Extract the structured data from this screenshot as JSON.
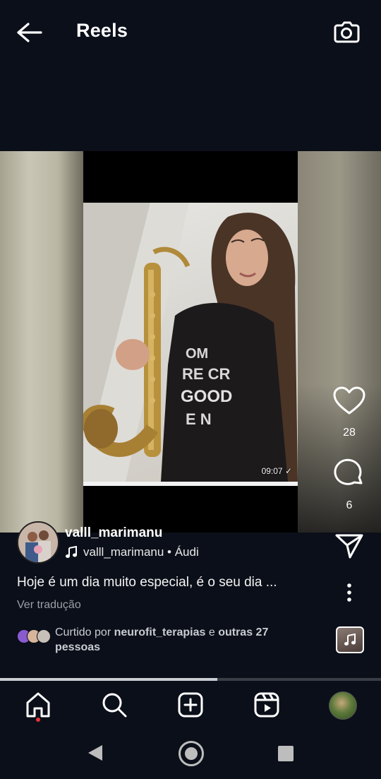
{
  "header": {
    "title": "Reels",
    "back_icon": "arrow-left-icon",
    "camera_icon": "camera-icon"
  },
  "video": {
    "timestamp": "09:07 ✓"
  },
  "actions": {
    "likes": "28",
    "comments": "6",
    "like_icon": "heart-icon",
    "comment_icon": "comment-icon",
    "share_icon": "send-icon",
    "more_icon": "more-vertical-icon"
  },
  "post": {
    "username": "valll_marimanu",
    "audio": "valll_marimanu • Áudi",
    "caption": "Hoje é um dia muito especial, é o seu dia ...",
    "translate_label": "Ver tradução",
    "liked_prefix": "Curtido por ",
    "liked_user": "neurofit_terapias",
    "liked_middle": " e ",
    "liked_others": "outras 27",
    "liked_suffix": "pessoas"
  },
  "progress": 0.57,
  "bottom_nav": {
    "items": [
      "home-icon",
      "search-icon",
      "add-post-icon",
      "reels-icon",
      "profile-avatar"
    ]
  },
  "system_nav": [
    "back-icon",
    "home-circle-icon",
    "recents-icon"
  ],
  "colors": {
    "background": "#0b0f19",
    "notification_dot": "#e8323b",
    "secondary_text": "#9aa0a6"
  }
}
